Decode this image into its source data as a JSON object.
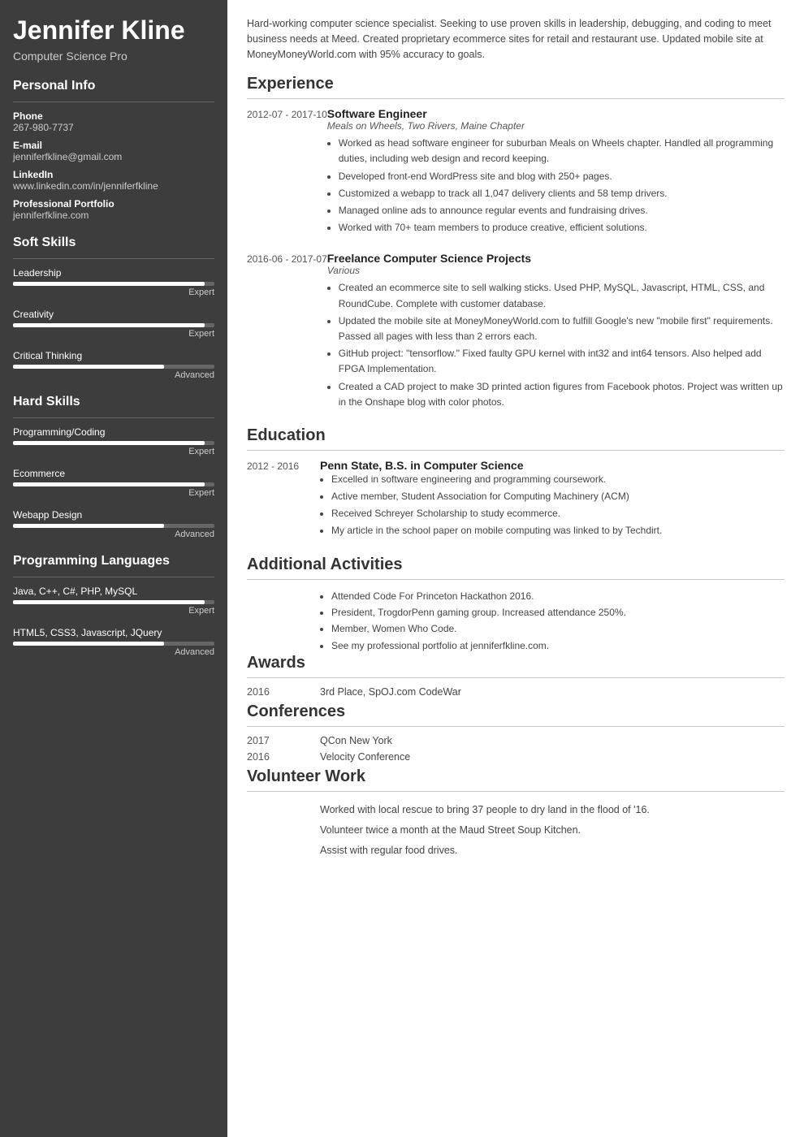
{
  "sidebar": {
    "name": "Jennifer Kline",
    "title": "Computer Science Pro",
    "personal_info": {
      "section_title": "Personal Info",
      "phone_label": "Phone",
      "phone_value": "267-980-7737",
      "email_label": "E-mail",
      "email_value": "jenniferfkline@gmail.com",
      "linkedin_label": "LinkedIn",
      "linkedin_value": "www.linkedin.com/in/jenniferfkline",
      "portfolio_label": "Professional Portfolio",
      "portfolio_value": "jenniferfkline.com"
    },
    "soft_skills": {
      "section_title": "Soft Skills",
      "items": [
        {
          "name": "Leadership",
          "level": "Expert",
          "percent": 95
        },
        {
          "name": "Creativity",
          "level": "Expert",
          "percent": 95
        },
        {
          "name": "Critical Thinking",
          "level": "Advanced",
          "percent": 75
        }
      ]
    },
    "hard_skills": {
      "section_title": "Hard Skills",
      "items": [
        {
          "name": "Programming/Coding",
          "level": "Expert",
          "percent": 95
        },
        {
          "name": "Ecommerce",
          "level": "Expert",
          "percent": 95
        },
        {
          "name": "Webapp Design",
          "level": "Advanced",
          "percent": 75
        }
      ]
    },
    "programming_languages": {
      "section_title": "Programming Languages",
      "items": [
        {
          "name": "Java, C++, C#, PHP, MySQL",
          "level": "Expert",
          "percent": 95
        },
        {
          "name": "HTML5, CSS3, Javascript, JQuery",
          "level": "Advanced",
          "percent": 75
        }
      ]
    }
  },
  "main": {
    "summary": "Hard-working computer science specialist. Seeking to use proven skills in leadership, debugging, and coding to meet business needs at Meed. Created proprietary ecommerce sites for retail and restaurant use. Updated mobile site at MoneyMoneyWorld.com with 95% accuracy to goals.",
    "experience": {
      "section_title": "Experience",
      "entries": [
        {
          "date": "2012-07 - 2017-10",
          "job_title": "Software Engineer",
          "company": "Meals on Wheels, Two Rivers, Maine Chapter",
          "bullets": [
            "Worked as head software engineer for suburban Meals on Wheels chapter. Handled all programming duties, including web design and record keeping.",
            "Developed front-end WordPress site and blog with 250+ pages.",
            "Customized a webapp to track all 1,047 delivery clients and 58 temp drivers.",
            "Managed online ads to announce regular events and fundraising drives.",
            "Worked with 70+ team members to produce creative, efficient solutions."
          ]
        },
        {
          "date": "2016-06 - 2017-07",
          "job_title": "Freelance Computer Science Projects",
          "company": "Various",
          "bullets": [
            "Created an ecommerce site to sell walking sticks. Used PHP, MySQL, Javascript, HTML, CSS, and RoundCube. Complete with customer database.",
            "Updated the mobile site at MoneyMoneyWorld.com to fulfill Google's new \"mobile first\" requirements. Passed all pages with less than 2 errors each.",
            "GitHub project: \"tensorflow.\" Fixed faulty GPU kernel with int32 and int64 tensors. Also helped add FPGA Implementation.",
            "Created a CAD project to make 3D printed action figures from Facebook photos. Project was written up in the Onshape blog with color photos."
          ]
        }
      ]
    },
    "education": {
      "section_title": "Education",
      "entries": [
        {
          "date": "2012 - 2016",
          "school": "Penn State, B.S. in Computer Science",
          "bullets": [
            "Excelled in software engineering and programming coursework.",
            "Active member, Student Association for Computing Machinery (ACM)",
            "Received Schreyer Scholarship to study ecommerce.",
            "My article in the school paper on mobile computing was linked to by Techdirt."
          ]
        }
      ]
    },
    "additional_activities": {
      "section_title": "Additional Activities",
      "bullets": [
        "Attended Code For Princeton Hackathon 2016.",
        "President, TrogdorPenn gaming group. Increased attendance 250%.",
        "Member, Women Who Code.",
        "See my professional portfolio at jenniferfkline.com."
      ]
    },
    "awards": {
      "section_title": "Awards",
      "entries": [
        {
          "date": "2016",
          "text": "3rd Place, SpOJ.com CodeWar"
        }
      ]
    },
    "conferences": {
      "section_title": "Conferences",
      "entries": [
        {
          "date": "2017",
          "text": "QCon New York"
        },
        {
          "date": "2016",
          "text": "Velocity Conference"
        }
      ]
    },
    "volunteer": {
      "section_title": "Volunteer Work",
      "lines": [
        "Worked with local rescue to bring 37 people to dry land in the flood of '16.",
        "Volunteer twice a month at the Maud Street Soup Kitchen.",
        "Assist with regular food drives."
      ]
    }
  }
}
